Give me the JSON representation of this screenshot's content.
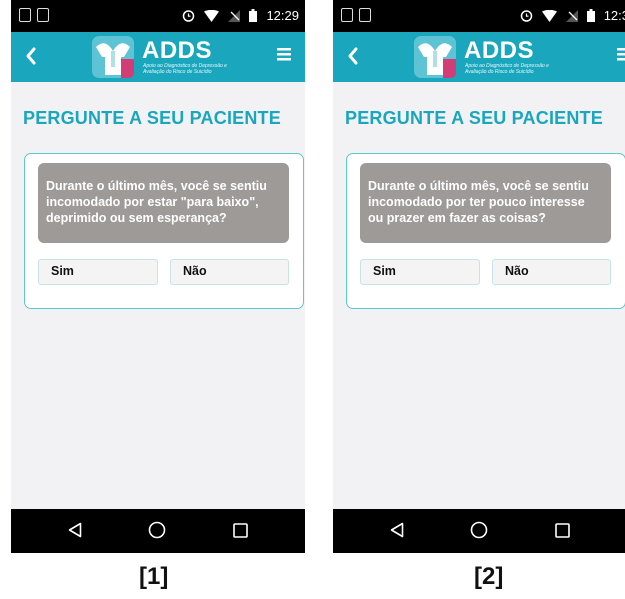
{
  "screens": [
    {
      "time": "12:29",
      "brand": "ADDS",
      "tagline": "Apoio ao Diagnóstico de Depressão e Avaliação do Risco de Suicídio",
      "title": "PERGUNTE A SEU PACIENTE",
      "question": "Durante o último mês, você se sentiu incomodado por estar \"para baixo\", deprimido ou sem esperança?",
      "answers": {
        "yes": "Sim",
        "no": "Não"
      },
      "caption": "[1]"
    },
    {
      "time": "12:3",
      "brand": "ADDS",
      "tagline": "Apoio ao Diagnóstico de Depressão e Avaliação do Risco de Suicídio",
      "title": "PERGUNTE A SEU PACIENTE",
      "question": "Durante o último mês, você se sentiu incomodado por ter pouco interesse ou prazer em fazer as coisas?",
      "answers": {
        "yes": "Sim",
        "no": "Não"
      },
      "caption": "[2]"
    }
  ],
  "colors": {
    "accent": "#1aa6bd",
    "card_border": "#5cc7cc",
    "question_bg": "#9d9a98",
    "logo_pink": "#d13d74"
  },
  "icons": [
    "phone-status-icon",
    "image-status-icon",
    "alarm-icon",
    "wifi-icon",
    "no-signal-icon",
    "battery-icon",
    "back-chevron-icon",
    "menu-icon",
    "nav-back-icon",
    "nav-home-icon",
    "nav-recents-icon"
  ]
}
